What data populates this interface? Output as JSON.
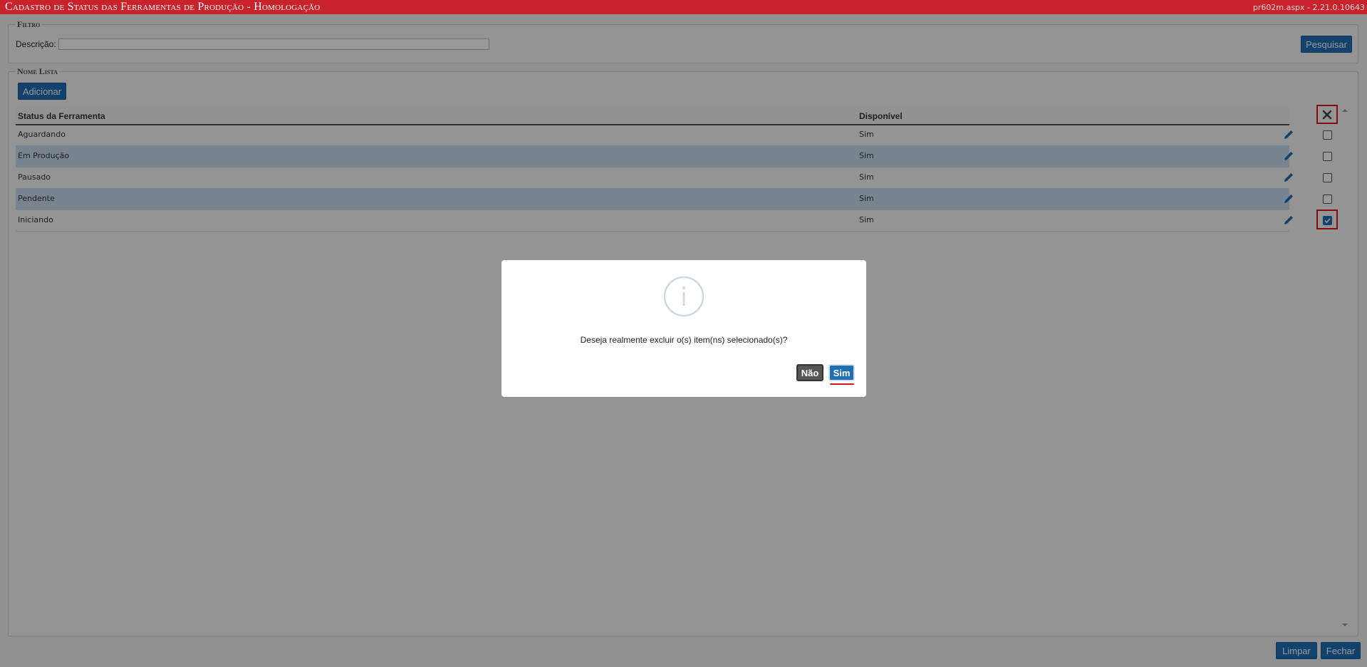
{
  "window": {
    "title": "Cadastro de Status das Ferramentas de Produção  - Homologação",
    "version": "pr602m.aspx - 2.21.0.10643"
  },
  "filter": {
    "legend": "Filtro",
    "description_label": "Descrição:",
    "description_value": "",
    "search_button": "Pesquisar"
  },
  "list": {
    "legend": "Nome Lista",
    "add_button": "Adicionar",
    "columns": [
      "Status da Ferramenta",
      "Disponível"
    ],
    "delete_icon": "close-icon",
    "rows": [
      {
        "status": "Aguardando",
        "available": "Sim",
        "checked": false
      },
      {
        "status": "Em Produção",
        "available": "Sim",
        "checked": false
      },
      {
        "status": "Pausado",
        "available": "Sim",
        "checked": false
      },
      {
        "status": "Pendente",
        "available": "Sim",
        "checked": false
      },
      {
        "status": "Iniciando",
        "available": "Sim",
        "checked": true
      }
    ]
  },
  "footer": {
    "clear_button": "Limpar",
    "close_button": "Fechar"
  },
  "dialog": {
    "icon": "info-icon",
    "message": "Deseja realmente excluir o(s) item(ns) selecionado(s)?",
    "no_button": "Não",
    "yes_button": "Sim"
  },
  "colors": {
    "titlebar": "#c8232c",
    "primary_button": "#1f6fb2",
    "alt_row": "#c9dcef",
    "highlight": "#e0121a"
  }
}
